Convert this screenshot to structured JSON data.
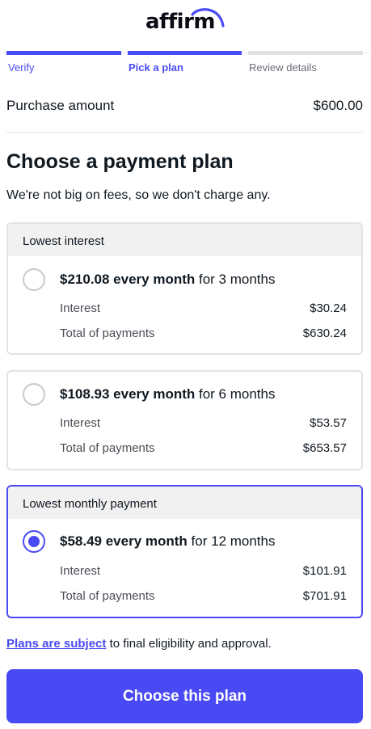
{
  "brand": {
    "logo_text": "affirm",
    "accent": "#4a4af4"
  },
  "steps": [
    {
      "label": "Verify",
      "state": "complete"
    },
    {
      "label": "Pick a plan",
      "state": "active"
    },
    {
      "label": "Review details",
      "state": "upcoming"
    }
  ],
  "purchase": {
    "label": "Purchase amount",
    "value": "$600.00"
  },
  "heading": "Choose a payment plan",
  "subheading": "We're not big on fees, so we don't charge any.",
  "plans": [
    {
      "tag": "Lowest interest",
      "amount": "$210.08 every month",
      "term": "for 3 months",
      "interest_label": "Interest",
      "interest": "$30.24",
      "total_label": "Total of payments",
      "total": "$630.24",
      "selected": false
    },
    {
      "tag": "",
      "amount": "$108.93 every month",
      "term": "for 6 months",
      "interest_label": "Interest",
      "interest": "$53.57",
      "total_label": "Total of payments",
      "total": "$653.57",
      "selected": false
    },
    {
      "tag": "Lowest monthly payment",
      "amount": "$58.49 every month",
      "term": "for 12 months",
      "interest_label": "Interest",
      "interest": "$101.91",
      "total_label": "Total of payments",
      "total": "$701.91",
      "selected": true
    }
  ],
  "disclaimer": {
    "link_text": "Plans are subject",
    "rest": " to final eligibility and approval."
  },
  "cta_label": "Choose this plan"
}
